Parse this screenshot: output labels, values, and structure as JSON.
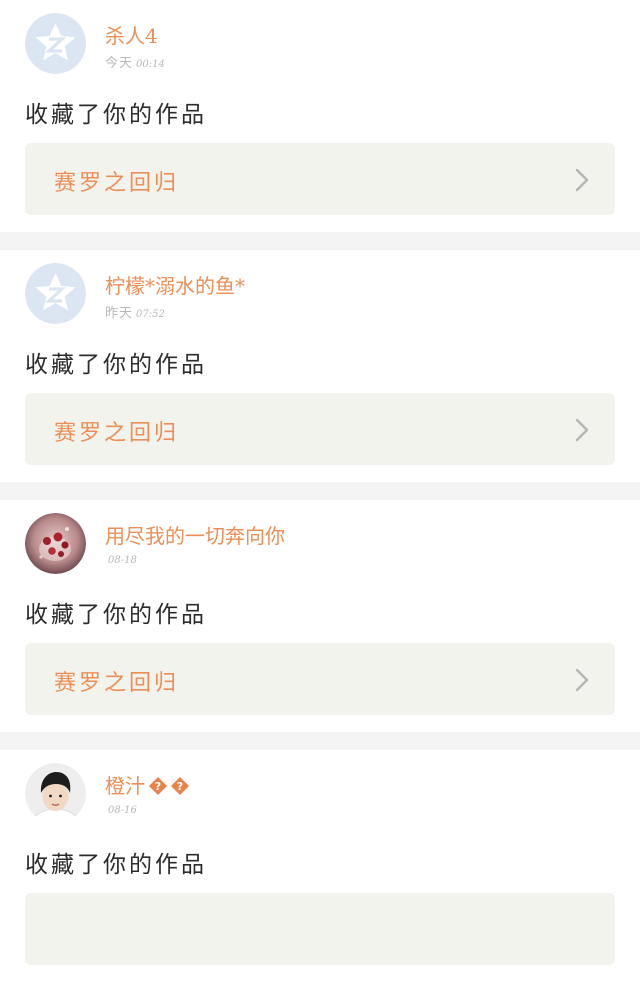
{
  "notifications": [
    {
      "avatar_type": "default-q",
      "username": "杀人4",
      "badges": 0,
      "time_day": "今天",
      "time_clock": "00:14",
      "action": "收藏了你的作品",
      "work_title": "赛罗之回归"
    },
    {
      "avatar_type": "default-q",
      "username": "柠檬*溺水的鱼*",
      "badges": 0,
      "time_day": "昨天",
      "time_clock": "07:52",
      "action": "收藏了你的作品",
      "work_title": "赛罗之回归"
    },
    {
      "avatar_type": "photo-roses",
      "username": "用尽我的一切奔向你",
      "badges": 0,
      "time_day": "",
      "time_clock": "08-18",
      "action": "收藏了你的作品",
      "work_title": "赛罗之回归"
    },
    {
      "avatar_type": "photo-boy",
      "username": "橙汁",
      "badges": 2,
      "time_day": "",
      "time_clock": "08-16",
      "action": "收藏了你的作品",
      "work_title": ""
    }
  ],
  "colors": {
    "accent": "#ec8f56",
    "card_bg": "#f3f3ee",
    "separator": "#f4f4f4",
    "default_avatar": "#dbe6f2"
  },
  "icons": {
    "chevron": "chevron-right-icon",
    "badge": "question-diamond-icon",
    "default_avatar": "qq-default-avatar-icon"
  }
}
